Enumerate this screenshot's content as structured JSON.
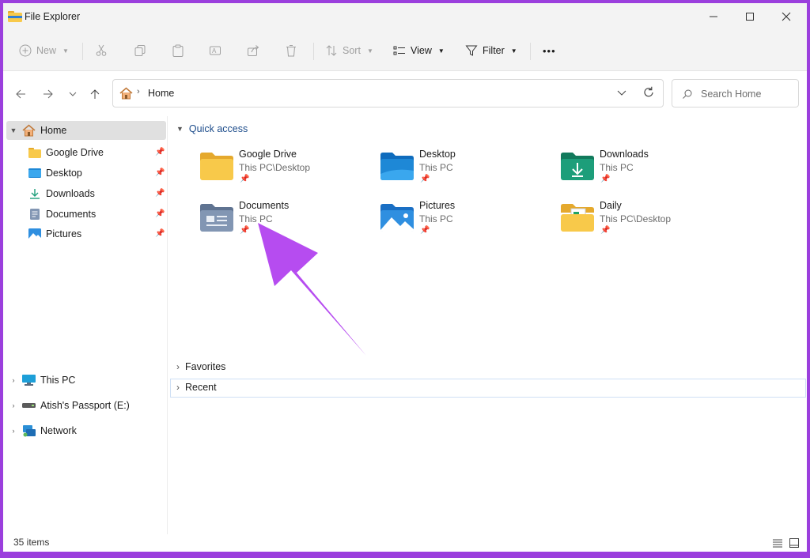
{
  "window": {
    "title": "File Explorer"
  },
  "toolbar": {
    "new_label": "New",
    "sort_label": "Sort",
    "view_label": "View",
    "filter_label": "Filter",
    "more_label": "•••"
  },
  "address": {
    "path": "Home"
  },
  "search": {
    "placeholder": "Search Home"
  },
  "sidebar": {
    "home": "Home",
    "pinned": [
      "Google Drive",
      "Desktop",
      "Downloads",
      "Documents",
      "Pictures"
    ],
    "this_pc": "This PC",
    "passport": "Atish's Passport  (E:)",
    "network": "Network"
  },
  "quick_access": {
    "title": "Quick access",
    "items": [
      {
        "name": "Google Drive",
        "location": "This PC\\Desktop"
      },
      {
        "name": "Desktop",
        "location": "This PC"
      },
      {
        "name": "Downloads",
        "location": "This PC"
      },
      {
        "name": "Documents",
        "location": "This PC"
      },
      {
        "name": "Pictures",
        "location": "This PC"
      },
      {
        "name": "Daily",
        "location": "This PC\\Desktop"
      }
    ]
  },
  "sections": {
    "favorites": "Favorites",
    "recent": "Recent"
  },
  "status": {
    "items_count": "35 items"
  },
  "colors": {
    "frame": "#9b3fdd",
    "arrow": "#b64cf0",
    "accent": "#1b4b8a",
    "folder_yellow": "#f8c94a"
  }
}
